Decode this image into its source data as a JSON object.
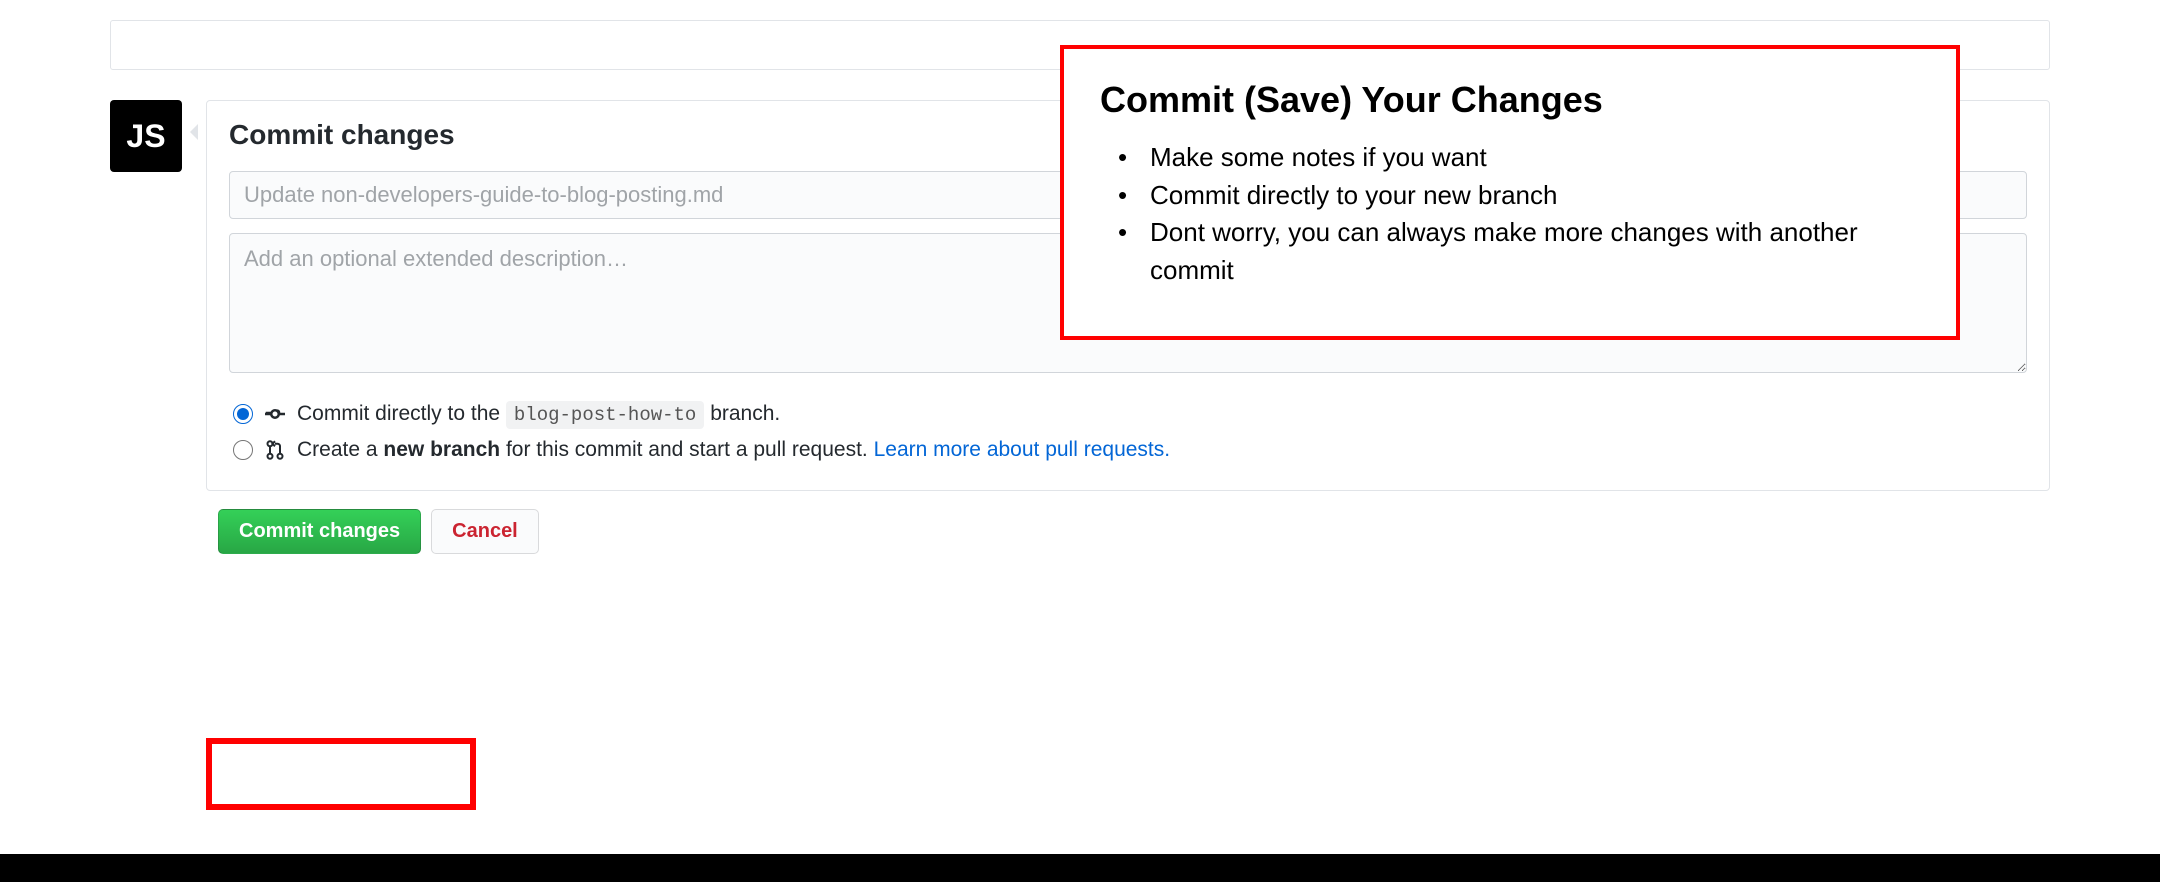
{
  "avatar": {
    "text": "JS"
  },
  "commit": {
    "heading": "Commit changes",
    "summary_placeholder": "Update non-developers-guide-to-blog-posting.md",
    "description_placeholder": "Add an optional extended description…",
    "option_direct_prefix": "Commit directly to the ",
    "option_direct_branch": "blog-post-how-to",
    "option_direct_suffix": " branch.",
    "option_newbranch_prefix": "Create a ",
    "option_newbranch_bold": "new branch",
    "option_newbranch_suffix": " for this commit and start a pull request. ",
    "option_newbranch_link": "Learn more about pull requests."
  },
  "buttons": {
    "commit": "Commit changes",
    "cancel": "Cancel"
  },
  "annotation": {
    "title": "Commit (Save) Your Changes",
    "items": [
      "Make some notes if you want",
      "Commit directly to your new branch",
      "Dont worry, you can always make more changes with another commit"
    ]
  }
}
